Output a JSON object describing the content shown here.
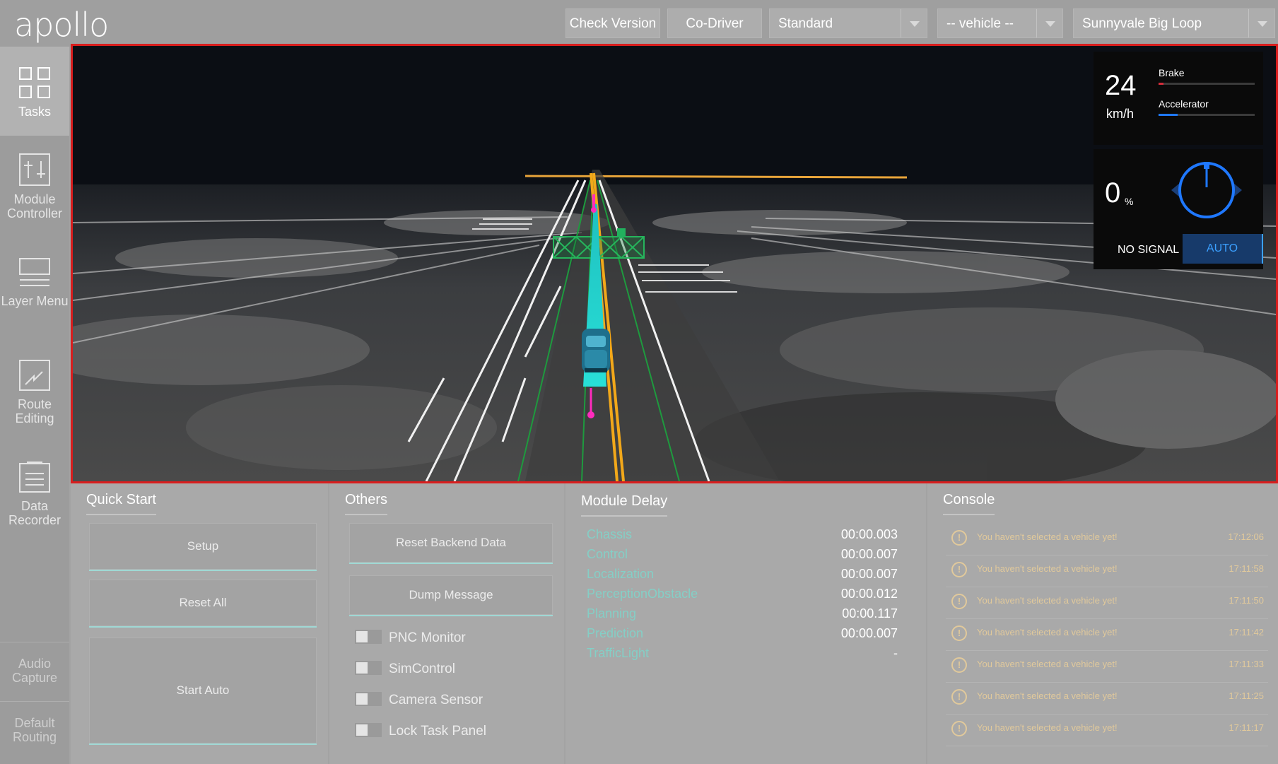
{
  "app": {
    "logo": "apollo"
  },
  "header": {
    "check_version": "Check Version",
    "co_driver": "Co-Driver",
    "mode_select": "Standard",
    "vehicle_select": "-- vehicle --",
    "map_select": "Sunnyvale Big Loop"
  },
  "sidebar": {
    "items": [
      {
        "label": "Tasks",
        "icon": "grid-icon",
        "active": true
      },
      {
        "label": "Module Controller",
        "icon": "sliders-icon"
      },
      {
        "label": "Layer Menu",
        "icon": "layers-icon"
      },
      {
        "label": "Route Editing",
        "icon": "route-icon"
      },
      {
        "label": "Data Recorder",
        "icon": "document-icon"
      },
      {
        "label": "Audio Capture"
      },
      {
        "label": "Default Routing"
      }
    ]
  },
  "hud": {
    "speed": "24",
    "speed_unit": "km/h",
    "brake_label": "Brake",
    "brake_level": 0.05,
    "accelerator_label": "Accelerator",
    "accelerator_level": 0.2,
    "steering": "0",
    "steering_unit": "%",
    "signal": "NO SIGNAL",
    "mode": "AUTO",
    "colors": {
      "brake": "#d42c3a",
      "accelerator": "#1f78ff",
      "wheel": "#1f78ff"
    }
  },
  "quick_start": {
    "title": "Quick Start",
    "setup": "Setup",
    "reset_all": "Reset All",
    "start_auto": "Start Auto"
  },
  "others": {
    "title": "Others",
    "reset_backend": "Reset Backend Data",
    "dump_message": "Dump Message",
    "toggles": [
      "PNC Monitor",
      "SimControl",
      "Camera Sensor",
      "Lock Task Panel"
    ]
  },
  "module_delay": {
    "title": "Module Delay",
    "rows": [
      {
        "name": "Chassis",
        "value": "00:00.003"
      },
      {
        "name": "Control",
        "value": "00:00.007"
      },
      {
        "name": "Localization",
        "value": "00:00.007"
      },
      {
        "name": "PerceptionObstacle",
        "value": "00:00.012"
      },
      {
        "name": "Planning",
        "value": "00:00.117"
      },
      {
        "name": "Prediction",
        "value": "00:00.007"
      },
      {
        "name": "TrafficLight",
        "value": "-"
      }
    ]
  },
  "console": {
    "title": "Console",
    "entries": [
      {
        "msg": "You haven't selected a vehicle yet!",
        "time": "17:12:06"
      },
      {
        "msg": "You haven't selected a vehicle yet!",
        "time": "17:11:58"
      },
      {
        "msg": "You haven't selected a vehicle yet!",
        "time": "17:11:50"
      },
      {
        "msg": "You haven't selected a vehicle yet!",
        "time": "17:11:42"
      },
      {
        "msg": "You haven't selected a vehicle yet!",
        "time": "17:11:33"
      },
      {
        "msg": "You haven't selected a vehicle yet!",
        "time": "17:11:25"
      },
      {
        "msg": "You haven't selected a vehicle yet!",
        "time": "17:11:17"
      }
    ]
  }
}
